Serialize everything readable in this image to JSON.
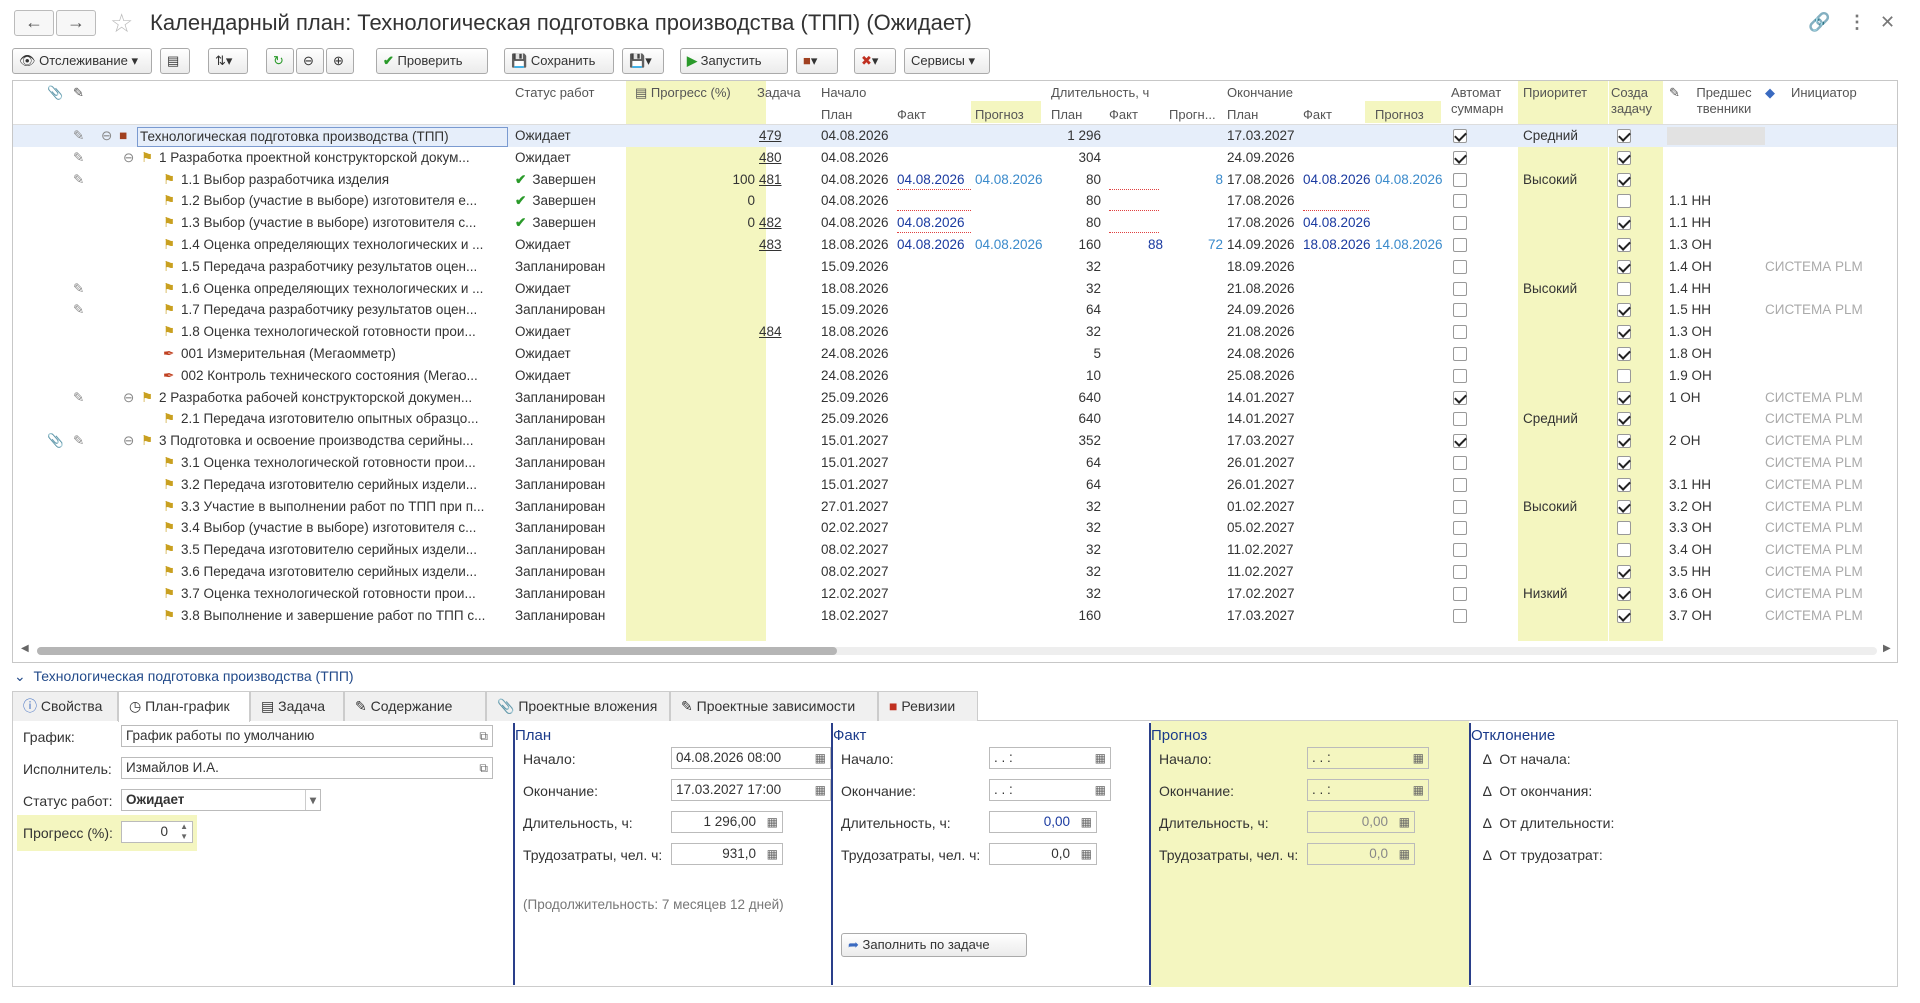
{
  "window": {
    "title": "Календарный план: Технологическая подготовка производства (ТПП) (Ожидает)"
  },
  "toolbar": {
    "tracking": "Отслеживание",
    "check": "Проверить",
    "save": "Сохранить",
    "start": "Запустить",
    "services": "Сервисы"
  },
  "grid": {
    "headers": {
      "status": "Статус работ",
      "progress": "Прогресс (%)",
      "task": "Задача",
      "start": "Начало",
      "duration": "Длительность, ч",
      "end": "Окончание",
      "auto": "Автомат суммарн",
      "priority": "Приоритет",
      "create": "Созда задачу",
      "pred": "Предшес твенники",
      "initiator": "Инициатор",
      "plan": "План",
      "fact": "Факт",
      "forecast": "Прогноз",
      "forecast_short": "Прогн..."
    },
    "rows": [
      {
        "name": "Технологическая подготовка производства (ТПП)",
        "level": 0,
        "status": "Ожидает",
        "progress": "",
        "task": "479",
        "s_plan": "04.08.2026",
        "s_fact": "",
        "s_fc": "",
        "d_plan": "1 296",
        "d_fact": "",
        "d_fc": "",
        "e_plan": "17.03.2027",
        "e_fact": "",
        "e_fc": "",
        "auto": true,
        "priority": "Средний",
        "create": true,
        "pred": "",
        "init": ""
      },
      {
        "name": "1 Разработка проектной конструкторской докум...",
        "level": 1,
        "status": "Ожидает",
        "progress": "",
        "task": "480",
        "s_plan": "04.08.2026",
        "s_fact": "",
        "s_fc": "",
        "d_plan": "304",
        "d_fact": "",
        "d_fc": "",
        "e_plan": "24.09.2026",
        "e_fact": "",
        "e_fc": "",
        "auto": true,
        "priority": "",
        "create": true,
        "pred": "",
        "init": ""
      },
      {
        "name": "1.1 Выбор разработчика изделия",
        "level": 2,
        "status": "Завершен",
        "done": true,
        "progress": "100",
        "task": "481",
        "s_plan": "04.08.2026",
        "s_fact": "04.08.2026",
        "s_fc": "04.08.2026",
        "d_plan": "80",
        "d_fact": "",
        "d_fc": "8",
        "e_plan": "17.08.2026",
        "e_fact": "04.08.2026",
        "e_fc": "04.08.2026",
        "auto": false,
        "priority": "Высокий",
        "create": true,
        "pred": "",
        "init": ""
      },
      {
        "name": "1.2 Выбор (участие в выборе) изготовителя е...",
        "level": 2,
        "status": "Завершен",
        "done": true,
        "progress": "0",
        "task": "",
        "s_plan": "04.08.2026",
        "s_fact": "",
        "s_fc": "",
        "d_plan": "80",
        "d_fact": "",
        "d_fc": "",
        "e_plan": "17.08.2026",
        "e_fact": "",
        "e_fc": "",
        "auto": false,
        "priority": "",
        "create": false,
        "pred": "1.1 НН",
        "init": ""
      },
      {
        "name": "1.3 Выбор (участие в выборе) изготовителя с...",
        "level": 2,
        "status": "Завершен",
        "done": true,
        "progress": "0",
        "task": "482",
        "s_plan": "04.08.2026",
        "s_fact": "04.08.2026",
        "s_fc": "",
        "d_plan": "80",
        "d_fact": "",
        "d_fc": "",
        "e_plan": "17.08.2026",
        "e_fact": "04.08.2026",
        "e_fc": "",
        "auto": false,
        "priority": "",
        "create": true,
        "pred": "1.1 НН",
        "init": ""
      },
      {
        "name": "1.4 Оценка определяющих технологических и ...",
        "level": 2,
        "status": "Ожидает",
        "progress": "",
        "task": "483",
        "s_plan": "18.08.2026",
        "s_fact": "04.08.2026",
        "s_fc": "04.08.2026",
        "d_plan": "160",
        "d_fact": "88",
        "d_fc": "72",
        "e_plan": "14.09.2026",
        "e_fact": "18.08.2026",
        "e_fc": "14.08.2026",
        "auto": false,
        "priority": "",
        "create": true,
        "pred": "1.3 ОН",
        "init": ""
      },
      {
        "name": "1.5 Передача разработчику результатов оцен...",
        "level": 2,
        "status": "Запланирован",
        "progress": "",
        "task": "",
        "s_plan": "15.09.2026",
        "s_fact": "",
        "s_fc": "",
        "d_plan": "32",
        "d_fact": "",
        "d_fc": "",
        "e_plan": "18.09.2026",
        "e_fact": "",
        "e_fc": "",
        "auto": false,
        "priority": "",
        "create": true,
        "pred": "1.4 ОН",
        "init": "СИСТЕМА PLM"
      },
      {
        "name": "1.6 Оценка определяющих технологических и ...",
        "level": 2,
        "status": "Ожидает",
        "progress": "",
        "task": "",
        "s_plan": "18.08.2026",
        "s_fact": "",
        "s_fc": "",
        "d_plan": "32",
        "d_fact": "",
        "d_fc": "",
        "e_plan": "21.08.2026",
        "e_fact": "",
        "e_fc": "",
        "auto": false,
        "priority": "Высокий",
        "create": false,
        "pred": "1.4 НН",
        "init": ""
      },
      {
        "name": "1.7 Передача разработчику результатов оцен...",
        "level": 2,
        "status": "Запланирован",
        "progress": "",
        "task": "",
        "s_plan": "15.09.2026",
        "s_fact": "",
        "s_fc": "",
        "d_plan": "64",
        "d_fact": "",
        "d_fc": "",
        "e_plan": "24.09.2026",
        "e_fact": "",
        "e_fc": "",
        "auto": false,
        "priority": "",
        "create": true,
        "pred": "1.5 НН",
        "init": "СИСТЕМА PLM"
      },
      {
        "name": "1.8 Оценка технологической готовности прои...",
        "level": 2,
        "status": "Ожидает",
        "progress": "",
        "task": "484",
        "s_plan": "18.08.2026",
        "s_fact": "",
        "s_fc": "",
        "d_plan": "32",
        "d_fact": "",
        "d_fc": "",
        "e_plan": "21.08.2026",
        "e_fact": "",
        "e_fc": "",
        "auto": false,
        "priority": "",
        "create": true,
        "pred": "1.3 ОН",
        "init": ""
      },
      {
        "name": "001 Измерительная (Мегаомметр)",
        "level": 2,
        "tool": true,
        "status": "Ожидает",
        "progress": "",
        "task": "",
        "s_plan": "24.08.2026",
        "s_fact": "",
        "s_fc": "",
        "d_plan": "5",
        "d_fact": "",
        "d_fc": "",
        "e_plan": "24.08.2026",
        "e_fact": "",
        "e_fc": "",
        "auto": false,
        "priority": "",
        "create": true,
        "pred": "1.8 ОН",
        "init": ""
      },
      {
        "name": "002 Контроль технического состояния (Мегао...",
        "level": 2,
        "tool": true,
        "status": "Ожидает",
        "progress": "",
        "task": "",
        "s_plan": "24.08.2026",
        "s_fact": "",
        "s_fc": "",
        "d_plan": "10",
        "d_fact": "",
        "d_fc": "",
        "e_plan": "25.08.2026",
        "e_fact": "",
        "e_fc": "",
        "auto": false,
        "priority": "",
        "create": false,
        "pred": "1.9 ОН",
        "init": ""
      },
      {
        "name": "2 Разработка рабочей конструкторской докумен...",
        "level": 1,
        "status": "Запланирован",
        "progress": "",
        "task": "",
        "s_plan": "25.09.2026",
        "s_fact": "",
        "s_fc": "",
        "d_plan": "640",
        "d_fact": "",
        "d_fc": "",
        "e_plan": "14.01.2027",
        "e_fact": "",
        "e_fc": "",
        "auto": true,
        "priority": "",
        "create": true,
        "pred": "1 ОН",
        "init": "СИСТЕМА PLM"
      },
      {
        "name": "2.1 Передача изготовителю опытных образцо...",
        "level": 2,
        "status": "Запланирован",
        "progress": "",
        "task": "",
        "s_plan": "25.09.2026",
        "s_fact": "",
        "s_fc": "",
        "d_plan": "640",
        "d_fact": "",
        "d_fc": "",
        "e_plan": "14.01.2027",
        "e_fact": "",
        "e_fc": "",
        "auto": false,
        "priority": "Средний",
        "create": true,
        "pred": "",
        "init": "СИСТЕМА PLM"
      },
      {
        "name": "3 Подготовка и освоение производства серийны...",
        "level": 1,
        "status": "Запланирован",
        "progress": "",
        "task": "",
        "s_plan": "15.01.2027",
        "s_fact": "",
        "s_fc": "",
        "d_plan": "352",
        "d_fact": "",
        "d_fc": "",
        "e_plan": "17.03.2027",
        "e_fact": "",
        "e_fc": "",
        "auto": true,
        "priority": "",
        "create": true,
        "pred": "2 ОН",
        "init": "СИСТЕМА PLM"
      },
      {
        "name": "3.1 Оценка технологической готовности прои...",
        "level": 2,
        "status": "Запланирован",
        "progress": "",
        "task": "",
        "s_plan": "15.01.2027",
        "s_fact": "",
        "s_fc": "",
        "d_plan": "64",
        "d_fact": "",
        "d_fc": "",
        "e_plan": "26.01.2027",
        "e_fact": "",
        "e_fc": "",
        "auto": false,
        "priority": "",
        "create": true,
        "pred": "",
        "init": "СИСТЕМА PLM"
      },
      {
        "name": "3.2 Передача изготовителю серийных издели...",
        "level": 2,
        "status": "Запланирован",
        "progress": "",
        "task": "",
        "s_plan": "15.01.2027",
        "s_fact": "",
        "s_fc": "",
        "d_plan": "64",
        "d_fact": "",
        "d_fc": "",
        "e_plan": "26.01.2027",
        "e_fact": "",
        "e_fc": "",
        "auto": false,
        "priority": "",
        "create": true,
        "pred": "3.1 НН",
        "init": "СИСТЕМА PLM"
      },
      {
        "name": "3.3 Участие в выполнении работ по ТПП при п...",
        "level": 2,
        "status": "Запланирован",
        "progress": "",
        "task": "",
        "s_plan": "27.01.2027",
        "s_fact": "",
        "s_fc": "",
        "d_plan": "32",
        "d_fact": "",
        "d_fc": "",
        "e_plan": "01.02.2027",
        "e_fact": "",
        "e_fc": "",
        "auto": false,
        "priority": "Высокий",
        "create": true,
        "pred": "3.2 ОН",
        "init": "СИСТЕМА PLM"
      },
      {
        "name": "3.4 Выбор (участие в выборе) изготовителя с...",
        "level": 2,
        "status": "Запланирован",
        "progress": "",
        "task": "",
        "s_plan": "02.02.2027",
        "s_fact": "",
        "s_fc": "",
        "d_plan": "32",
        "d_fact": "",
        "d_fc": "",
        "e_plan": "05.02.2027",
        "e_fact": "",
        "e_fc": "",
        "auto": false,
        "priority": "",
        "create": false,
        "pred": "3.3 ОН",
        "init": "СИСТЕМА PLM"
      },
      {
        "name": "3.5 Передача изготовителю серийных издели...",
        "level": 2,
        "status": "Запланирован",
        "progress": "",
        "task": "",
        "s_plan": "08.02.2027",
        "s_fact": "",
        "s_fc": "",
        "d_plan": "32",
        "d_fact": "",
        "d_fc": "",
        "e_plan": "11.02.2027",
        "e_fact": "",
        "e_fc": "",
        "auto": false,
        "priority": "",
        "create": false,
        "pred": "3.4 ОН",
        "init": "СИСТЕМА PLM"
      },
      {
        "name": "3.6 Передача изготовителю серийных издели...",
        "level": 2,
        "status": "Запланирован",
        "progress": "",
        "task": "",
        "s_plan": "08.02.2027",
        "s_fact": "",
        "s_fc": "",
        "d_plan": "32",
        "d_fact": "",
        "d_fc": "",
        "e_plan": "11.02.2027",
        "e_fact": "",
        "e_fc": "",
        "auto": false,
        "priority": "",
        "create": true,
        "pred": "3.5 НН",
        "init": "СИСТЕМА PLM"
      },
      {
        "name": "3.7 Оценка технологической готовности прои...",
        "level": 2,
        "status": "Запланирован",
        "progress": "",
        "task": "",
        "s_plan": "12.02.2027",
        "s_fact": "",
        "s_fc": "",
        "d_plan": "32",
        "d_fact": "",
        "d_fc": "",
        "e_plan": "17.02.2027",
        "e_fact": "",
        "e_fc": "",
        "auto": false,
        "priority": "Низкий",
        "create": true,
        "pred": "3.6 ОН",
        "init": "СИСТЕМА PLM"
      },
      {
        "name": "3.8 Выполнение и завершение работ по ТПП с...",
        "level": 2,
        "status": "Запланирован",
        "progress": "",
        "task": "",
        "s_plan": "18.02.2027",
        "s_fact": "",
        "s_fc": "",
        "d_plan": "160",
        "d_fact": "",
        "d_fc": "",
        "e_plan": "17.03.2027",
        "e_fact": "",
        "e_fc": "",
        "auto": false,
        "priority": "",
        "create": true,
        "pred": "3.7 ОН",
        "init": "СИСТЕМА PLM"
      }
    ]
  },
  "detail": {
    "section_title": "Технологическая подготовка производства (ТПП)",
    "tabs": [
      "Свойства",
      "План-график",
      "Задача",
      "Содержание",
      "Проектные вложения",
      "Проектные зависимости",
      "Ревизии"
    ],
    "active_tab": "План-график",
    "schedule_label": "График:",
    "schedule_value": "График работы по умолчанию",
    "executor_label": "Исполнитель:",
    "executor_value": "Измайлов И.А.",
    "status_label": "Статус работ:",
    "status_value": "Ожидает",
    "progress_label": "Прогресс (%):",
    "progress_value": "0",
    "plan": {
      "title": "План",
      "start_label": "Начало:",
      "start_value": "04.08.2026 08:00",
      "end_label": "Окончание:",
      "end_value": "17.03.2027 17:00",
      "dur_label": "Длительность, ч:",
      "dur_value": "1 296,00",
      "labor_label": "Трудозатраты, чел. ч:",
      "labor_value": "931,0",
      "note": "(Продолжительность: 7 месяцев 12 дней)"
    },
    "fact": {
      "title": "Факт",
      "start_label": "Начало:",
      "start_value": " .  .       :",
      "end_label": "Окончание:",
      "end_value": " .  .       :",
      "dur_label": "Длительность, ч:",
      "dur_value": "0,00",
      "labor_label": "Трудозатраты, чел. ч:",
      "labor_value": "0,0",
      "fill_button": "Заполнить по задаче"
    },
    "forecast": {
      "title": "Прогноз",
      "start_label": "Начало:",
      "start_value": " .  .       :",
      "end_label": "Окончание:",
      "end_value": " .  .       :",
      "dur_label": "Длительность, ч:",
      "dur_value": "0,00",
      "labor_label": "Трудозатраты, чел. ч:",
      "labor_value": "0,0"
    },
    "deviation": {
      "title": "Отклонение",
      "from_start": "От начала:",
      "from_end": "От окончания:",
      "from_dur": "От длительности:",
      "from_labor": "От трудозатрат:"
    }
  }
}
